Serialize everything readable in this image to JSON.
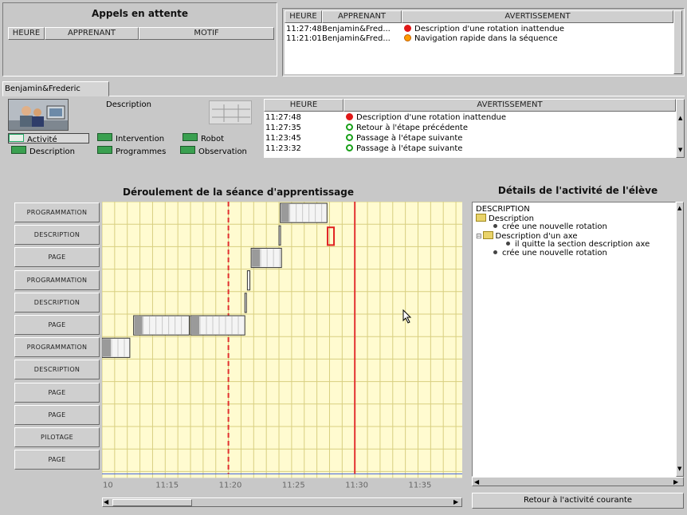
{
  "waiting_calls": {
    "title": "Appels en attente",
    "columns": [
      "HEURE",
      "APPRENANT",
      "MOTIF"
    ]
  },
  "global_warnings": {
    "columns": [
      "HEURE",
      "APPRENANT",
      "AVERTISSEMENT"
    ],
    "rows": [
      {
        "time": "11:27:48",
        "learner": "Benjamin&Fred...",
        "status": "red",
        "message": "Description d'une rotation inattendue"
      },
      {
        "time": "11:21:01",
        "learner": "Benjamin&Fred...",
        "status": "orange",
        "message": "Navigation rapide dans la séquence"
      }
    ]
  },
  "learner_tab": {
    "label": "Benjamin&Frederic"
  },
  "description_label": "Description",
  "legend": [
    {
      "label": "Activité",
      "active": true
    },
    {
      "label": "Intervention",
      "active": false
    },
    {
      "label": "Robot",
      "active": false
    },
    {
      "label": "Description",
      "active": false
    },
    {
      "label": "Programmes",
      "active": false
    },
    {
      "label": "Observation",
      "active": false
    }
  ],
  "learner_warnings": {
    "columns": [
      "HEURE",
      "AVERTISSEMENT"
    ],
    "rows": [
      {
        "time": "11:27:48",
        "status": "red",
        "message": "Description d'une rotation inattendue"
      },
      {
        "time": "11:27:35",
        "status": "green",
        "message": "Retour à l'étape précédente"
      },
      {
        "time": "11:23:45",
        "status": "green",
        "message": "Passage à l'étape suivante"
      },
      {
        "time": "11:23:32",
        "status": "green",
        "message": "Passage à l'étape suivante"
      }
    ]
  },
  "timeline": {
    "title": "Déroulement de la séance d'apprentissage",
    "row_labels": [
      "PROGRAMMATION",
      "DESCRIPTION",
      "PAGE",
      "PROGRAMMATION",
      "DESCRIPTION",
      "PAGE",
      "PROGRAMMATION",
      "DESCRIPTION",
      "PAGE",
      "PAGE",
      "PILOTAGE",
      "PAGE"
    ],
    "x_ticks": [
      "10",
      "11:15",
      "11:20",
      "11:25",
      "11:30",
      "11:35"
    ],
    "tick_minutes": [
      10,
      15,
      20,
      25,
      30,
      35
    ],
    "x_range_minutes": [
      10,
      38.5
    ],
    "dashed_marker_minute": 20,
    "solid_marker_minute": 30,
    "colors": {
      "background": "#fffbd0",
      "grid": "#d8cf80",
      "dashed": "#e23030",
      "solid": "#e23030"
    },
    "blocks": [
      {
        "row": 6,
        "start": 10.0,
        "end": 12.2
      },
      {
        "row": 5,
        "start": 12.5,
        "end": 16.9
      },
      {
        "row": 5,
        "start": 17.0,
        "end": 21.3
      },
      {
        "row": 4,
        "start": 21.3,
        "end": 21.4
      },
      {
        "row": 3,
        "start": 21.5,
        "end": 21.7
      },
      {
        "row": 2,
        "start": 21.8,
        "end": 24.2
      },
      {
        "row": 1,
        "start": 24.0,
        "end": 24.1
      },
      {
        "row": 0,
        "start": 24.1,
        "end": 27.8
      }
    ],
    "highlight": {
      "row": 1,
      "minute": 28.1
    }
  },
  "details": {
    "title": "Détails de l'activité de l'élève",
    "tree": [
      {
        "level": 0,
        "text": "DESCRIPTION",
        "icon": "none"
      },
      {
        "level": 0,
        "text": "Description",
        "icon": "folder-icon"
      },
      {
        "level": 1,
        "text": "crée une nouvelle rotation",
        "icon": "bullet-icon"
      },
      {
        "level": 0,
        "text": "Description d'un axe",
        "icon": "folder-icon",
        "expander": "⊟"
      },
      {
        "level": 2,
        "text": "il quitte la section description axe",
        "icon": "bullet-icon"
      },
      {
        "level": 1,
        "text": "crée une nouvelle rotation",
        "icon": "bullet-icon"
      }
    ],
    "return_button": "Retour à l'activité courante"
  }
}
